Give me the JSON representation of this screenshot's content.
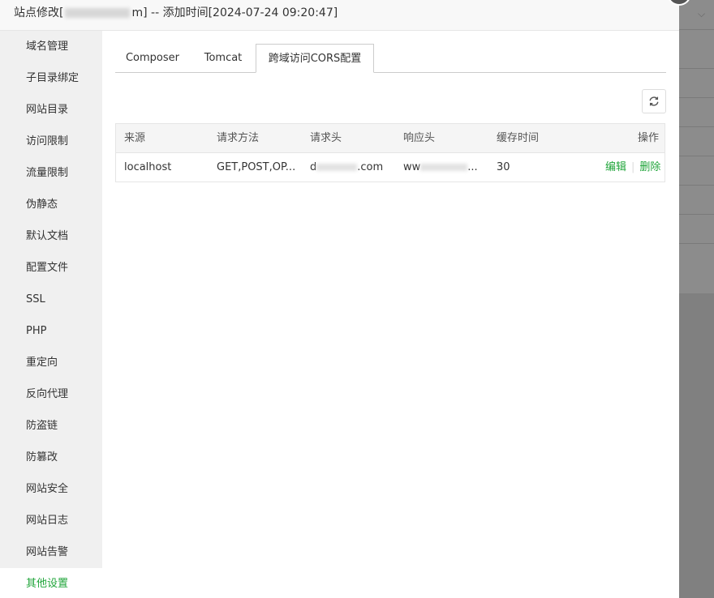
{
  "dialog": {
    "title_prefix": "站点修改[",
    "title_suffix": "m] -- 添加时间[2024-07-24 09:20:47]"
  },
  "sidebar": {
    "items": [
      {
        "label": "域名管理"
      },
      {
        "label": "子目录绑定"
      },
      {
        "label": "网站目录"
      },
      {
        "label": "访问限制"
      },
      {
        "label": "流量限制"
      },
      {
        "label": "伪静态"
      },
      {
        "label": "默认文档"
      },
      {
        "label": "配置文件"
      },
      {
        "label": "SSL"
      },
      {
        "label": "PHP"
      },
      {
        "label": "重定向"
      },
      {
        "label": "反向代理"
      },
      {
        "label": "防盗链"
      },
      {
        "label": "防篡改"
      },
      {
        "label": "网站安全"
      },
      {
        "label": "网站日志"
      },
      {
        "label": "网站告警"
      },
      {
        "label": "其他设置",
        "active": true
      }
    ]
  },
  "tabs": [
    {
      "label": "Composer"
    },
    {
      "label": "Tomcat"
    },
    {
      "label": "跨域访问CORS配置",
      "active": true
    }
  ],
  "table": {
    "columns": [
      "来源",
      "请求方法",
      "请求头",
      "响应头",
      "缓存时间",
      "操作"
    ],
    "rows": [
      {
        "origin": "localhost",
        "methods": "GET,POST,OP...",
        "req_headers_prefix": "d",
        "req_headers_suffix": ".com",
        "resp_headers_prefix": "ww",
        "resp_headers_suffix": "...",
        "max_age": "30",
        "edit_label": "编辑",
        "delete_label": "删除"
      }
    ]
  },
  "colors": {
    "accent": "#20a53a",
    "sidebar_bg": "#f0f0f0"
  }
}
